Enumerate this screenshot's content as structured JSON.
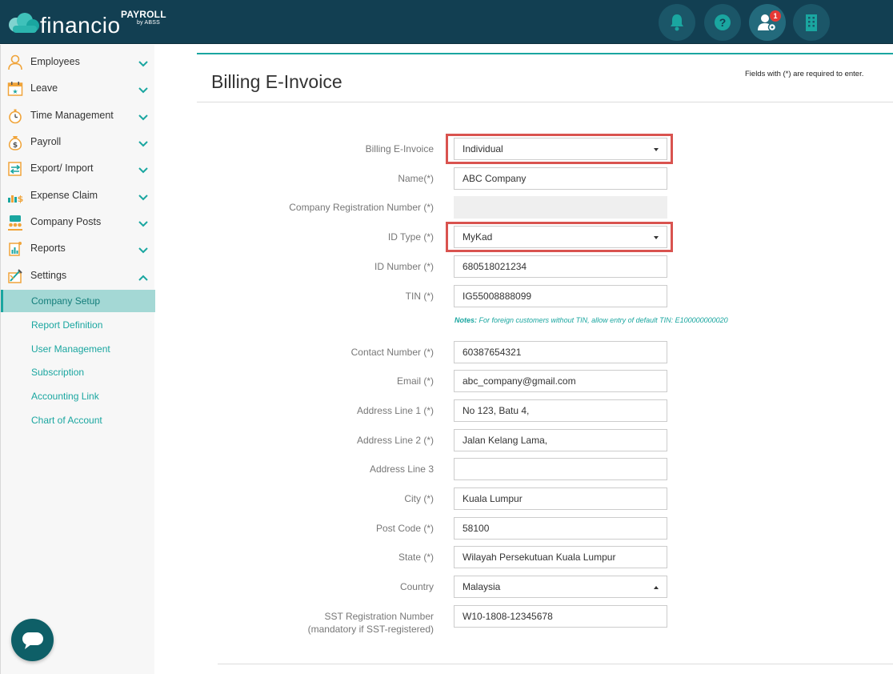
{
  "header": {
    "logo_word": "financio",
    "logo_payroll": "PAYROLL",
    "logo_by": "by ABSS",
    "notification_count": "1",
    "icons": [
      "bell-icon",
      "help-icon",
      "user-settings-icon",
      "building-icon"
    ]
  },
  "sidebar": {
    "items": [
      {
        "label": "Employees",
        "icon": "employee-icon"
      },
      {
        "label": "Leave",
        "icon": "calendar-icon"
      },
      {
        "label": "Time Management",
        "icon": "stopwatch-icon"
      },
      {
        "label": "Payroll",
        "icon": "money-bag-icon"
      },
      {
        "label": "Export/ Import",
        "icon": "export-import-icon"
      },
      {
        "label": "Expense Claim",
        "icon": "expense-icon"
      },
      {
        "label": "Company Posts",
        "icon": "posts-icon"
      },
      {
        "label": "Reports",
        "icon": "reports-icon"
      },
      {
        "label": "Settings",
        "icon": "settings-icon"
      }
    ],
    "subitems": [
      {
        "label": "Company Setup",
        "active": true
      },
      {
        "label": "Report Definition"
      },
      {
        "label": "User Management"
      },
      {
        "label": "Subscription"
      },
      {
        "label": "Accounting Link"
      },
      {
        "label": "Chart of Account"
      }
    ]
  },
  "page": {
    "title": "Billing E-Invoice",
    "required_note": "Fields with (*) are required to enter."
  },
  "form": {
    "billing_einvoice": {
      "label": "Billing E-Invoice",
      "value": "Individual"
    },
    "name": {
      "label": "Name(*)",
      "value": "ABC Company"
    },
    "company_reg": {
      "label": "Company Registration Number (*)",
      "value": ""
    },
    "id_type": {
      "label": "ID Type (*)",
      "value": "MyKad"
    },
    "id_number": {
      "label": "ID Number (*)",
      "value": "680518021234"
    },
    "tin": {
      "label": "TIN (*)",
      "value": "IG55008888099"
    },
    "notes_label": "Notes:",
    "notes_text": "For foreign customers without TIN, allow entry of default TIN: E100000000020",
    "contact": {
      "label": "Contact Number (*)",
      "value": "60387654321"
    },
    "email": {
      "label": "Email (*)",
      "value": "abc_company@gmail.com"
    },
    "address1": {
      "label": "Address Line 1 (*)",
      "value": "No 123, Batu 4,"
    },
    "address2": {
      "label": "Address Line 2 (*)",
      "value": "Jalan Kelang Lama,"
    },
    "address3": {
      "label": "Address Line 3",
      "value": ""
    },
    "city": {
      "label": "City (*)",
      "value": "Kuala Lumpur"
    },
    "postcode": {
      "label": "Post Code (*)",
      "value": "58100"
    },
    "state": {
      "label": "State (*)",
      "value": "Wilayah Persekutuan Kuala Lumpur"
    },
    "country": {
      "label": "Country",
      "value": "Malaysia"
    },
    "sst": {
      "label": "SST Registration Number",
      "label2": "(mandatory if SST-registered)",
      "value": "W10-1808-12345678"
    }
  }
}
